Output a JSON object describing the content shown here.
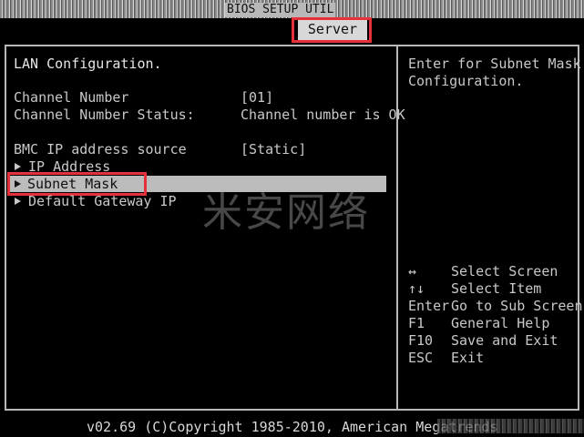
{
  "header": {
    "title": "BIOS SETUP UTIL",
    "tab": "Server"
  },
  "main": {
    "section_title": "LAN Configuration.",
    "rows": [
      {
        "label": "Channel Number",
        "value": "[01]"
      },
      {
        "label": "Channel Number Status:",
        "value": "Channel number is OK"
      },
      {
        "label": "BMC IP address source",
        "value": "[Static]"
      }
    ],
    "submenus": [
      {
        "label": "IP Address"
      },
      {
        "label": "Subnet Mask"
      },
      {
        "label": "Default Gateway IP"
      }
    ]
  },
  "help": {
    "line1": "Enter for Subnet Mask",
    "line2": "Configuration."
  },
  "keys": [
    {
      "key": "↔",
      "action": "Select Screen"
    },
    {
      "key": "↑↓",
      "action": "Select Item"
    },
    {
      "key": "Enter",
      "action": "Go to Sub Screen"
    },
    {
      "key": "F1",
      "action": "General Help"
    },
    {
      "key": "F10",
      "action": "Save and Exit"
    },
    {
      "key": "ESC",
      "action": "Exit"
    }
  ],
  "watermark": "米安网络",
  "footer": "v02.69 (C)Copyright 1985-2010, American Megatrends"
}
